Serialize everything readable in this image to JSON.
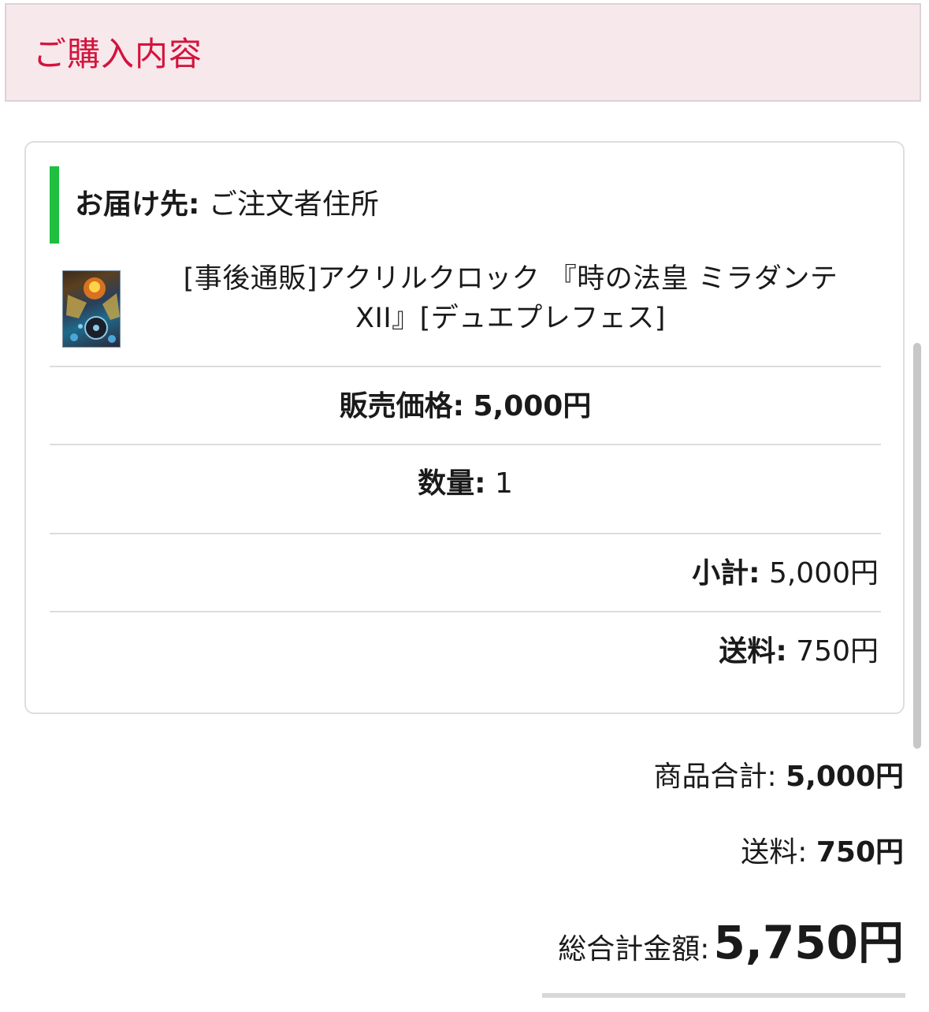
{
  "header": {
    "title": "ご購入内容"
  },
  "shipping": {
    "label": "お届け先:",
    "value": "ご注文者住所"
  },
  "product": {
    "name_line1": "[事後通販]アクリルクロック 『時の法皇 ミラダンテ",
    "name_line2": "XII』[デュエプレフェス]",
    "price_label": "販売価格:",
    "price_value": "5,000円",
    "quantity_label": "数量:",
    "quantity_value": "1",
    "subtotal_label": "小計:",
    "subtotal_value": "5,000円",
    "shipping_fee_label": "送料:",
    "shipping_fee_value": "750円"
  },
  "summary": {
    "items_total_label": "商品合計:",
    "items_total_value": "5,000円",
    "shipping_label": "送料:",
    "shipping_value": "750円",
    "grand_total_label": "総合計金額:",
    "grand_total_value": "5,750円"
  },
  "colors": {
    "accent": "#d3143c",
    "header_bg": "#f7e8ec",
    "shipping_bar": "#1fbf3f"
  }
}
